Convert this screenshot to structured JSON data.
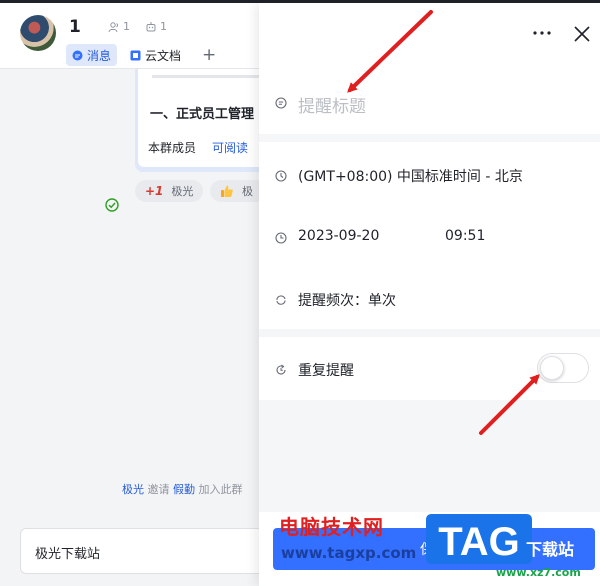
{
  "chat": {
    "title": "1",
    "members_count": "1",
    "bots_count": "1",
    "tabs": [
      {
        "label": "消息",
        "icon": "chat-bubble-icon",
        "active": true
      },
      {
        "label": "云文档",
        "icon": "doc-icon",
        "active": false
      }
    ],
    "add_tab": "+",
    "message": {
      "heading": "一、正式员工管理",
      "members_label": "本群成员",
      "readable_label": "可阅读",
      "reactions": [
        {
          "emoji": "+1",
          "user": "极光"
        },
        {
          "emoji": "thumbs-up",
          "user": "极"
        }
      ]
    },
    "system_note": {
      "user": "极光",
      "action": "邀请",
      "target": "假勤",
      "suffix": "加入此群"
    },
    "compose_text": "极光下载站"
  },
  "reminder_panel": {
    "title_placeholder": "提醒标题",
    "timezone": "(GMT+08:00) 中国标准时间 - 北京",
    "date": "2023-09-20",
    "time": "09:51",
    "frequency": "提醒频次：单次",
    "repeat_label": "重复提醒",
    "repeat_enabled": false,
    "save_label": "保存"
  },
  "watermark": {
    "name": "电脑技术网",
    "url": "www.tagxp.com",
    "tag": "TAG",
    "site": "下载站",
    "url2": "www.xz7.com"
  },
  "colors": {
    "accent": "#3370ff",
    "annotation_arrow": "#e02020",
    "panel_bg": "#f5f6f7"
  }
}
